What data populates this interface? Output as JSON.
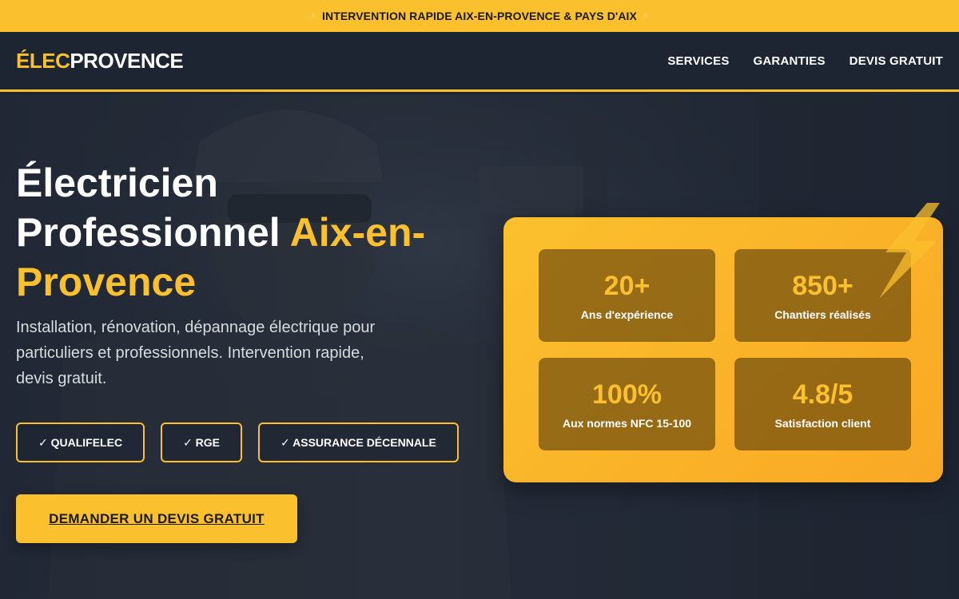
{
  "topbar": {
    "text": "INTERVENTION RAPIDE AIX-EN-PROVENCE & PAYS D'AIX",
    "bolt": "⚡"
  },
  "brand": {
    "part1": "ÉLEC",
    "part2": "PROVENCE",
    "accent": "#fbc02d"
  },
  "nav": {
    "items": [
      {
        "label": "SERVICES"
      },
      {
        "label": "GARANTIES"
      },
      {
        "label": "DEVIS GRATUIT"
      }
    ]
  },
  "hero": {
    "title_line1": "Électricien",
    "title_line2": "Professionnel ",
    "title_highlight_1": "Aix-en-",
    "title_highlight_2": "Provence",
    "subtitle": "Installation, rénovation, dépannage électrique pour particuliers et professionnels. Intervention rapide, devis gratuit.",
    "badges": [
      {
        "label": "✓ QUALIFELEC"
      },
      {
        "label": "✓ RGE"
      },
      {
        "label": "✓ ASSURANCE DÉCENNALE"
      }
    ],
    "cta_label": "DEMANDER UN DEVIS GRATUIT"
  },
  "stats": [
    {
      "value": "20+",
      "label": "Ans d'expérience"
    },
    {
      "value": "850+",
      "label": "Chantiers réalisés"
    },
    {
      "value": "100%",
      "label": "Aux normes NFC 15-100"
    },
    {
      "value": "4.8/5",
      "label": "Satisfaction client"
    }
  ],
  "icons": {
    "decoration": "lightning-bolt-icon"
  },
  "colors": {
    "accent": "#fbc02d",
    "dark": "#1e2532"
  }
}
